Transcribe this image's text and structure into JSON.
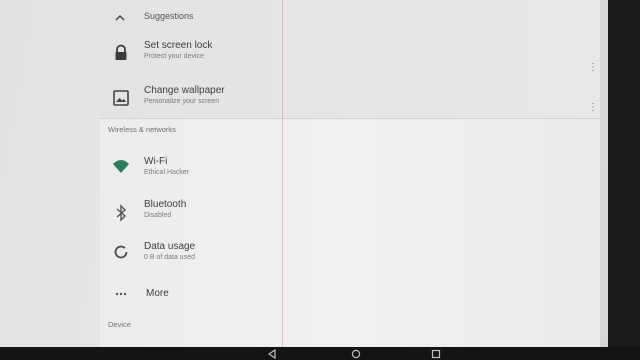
{
  "suggestions": {
    "header": "Suggestions",
    "items": [
      {
        "title": "Set screen lock",
        "subtitle": "Protect your device",
        "icon": "lock-icon"
      },
      {
        "title": "Change wallpaper",
        "subtitle": "Personalize your screen",
        "icon": "wallpaper-icon"
      }
    ]
  },
  "wireless": {
    "header": "Wireless & networks",
    "items": [
      {
        "title": "Wi-Fi",
        "subtitle": "Ethical Hacker",
        "icon": "wifi-icon"
      },
      {
        "title": "Bluetooth",
        "subtitle": "Disabled",
        "icon": "bluetooth-icon"
      },
      {
        "title": "Data usage",
        "subtitle": "0 B of data used",
        "icon": "data-usage-icon"
      }
    ],
    "more_label": "More"
  },
  "device": {
    "header": "Device"
  },
  "colors": {
    "accent": "#2e7d5b",
    "icon_gray": "#5a5a5a",
    "background": "#ececec"
  }
}
